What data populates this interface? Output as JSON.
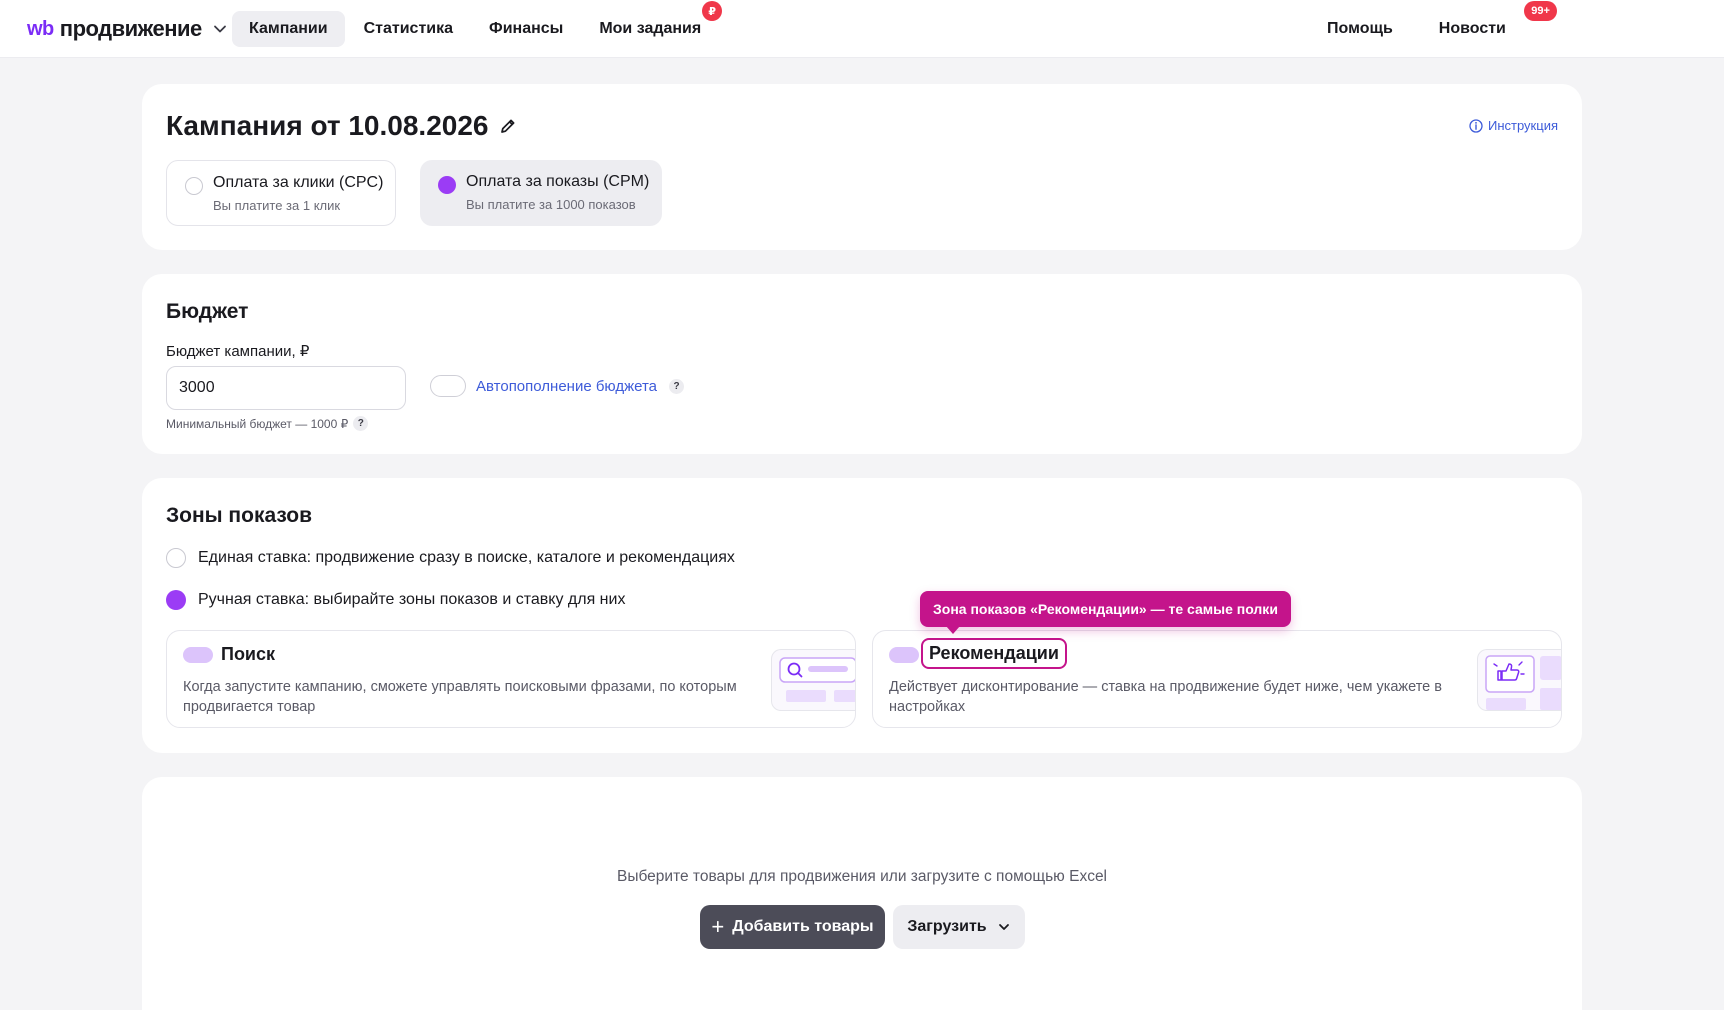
{
  "header": {
    "logo_mark": "wb",
    "logo_word": "продвижение",
    "nav": [
      {
        "label": "Кампании",
        "active": true
      },
      {
        "label": "Статистика",
        "active": false
      },
      {
        "label": "Финансы",
        "active": false
      },
      {
        "label": "Мои задания",
        "active": false,
        "badge": "₽"
      }
    ],
    "right": [
      {
        "label": "Помощь"
      },
      {
        "label": "Новости",
        "badge": "99+"
      }
    ]
  },
  "campaign": {
    "title": "Кампания от 10.08.2026",
    "instruction_link": "Инструкция",
    "payment_options": [
      {
        "label": "Оплата за клики (CPC)",
        "sub": "Вы платите за 1 клик",
        "selected": false
      },
      {
        "label": "Оплата за показы (CPM)",
        "sub": "Вы платите за 1000 показов",
        "selected": true
      }
    ]
  },
  "budget": {
    "title": "Бюджет",
    "field_label": "Бюджет кампании, ₽",
    "value": "3000",
    "hint": "Минимальный бюджет — 1000 ₽",
    "autofill_label": "Автопополнение бюджета",
    "help_mark": "?"
  },
  "zones": {
    "title": "Зоны показов",
    "options": [
      {
        "label": "Единая ставка: продвижение сразу в поиске, каталоге и рекомендациях",
        "selected": false
      },
      {
        "label": "Ручная ставка: выбирайте зоны показов и ставку для них",
        "selected": true
      }
    ],
    "cards": [
      {
        "name": "Поиск",
        "desc": "Когда запустите кампанию, сможете управлять поисковыми фразами, по которым продвигается товар"
      },
      {
        "name": "Рекомендации",
        "desc": "Действует дисконтирование — ставка на продвижение будет ниже, чем укажете в настройках"
      }
    ],
    "tooltip": "Зона показов «Рекомендации» — те самые полки"
  },
  "products": {
    "empty_text": "Выберите товары для продвижения или загрузите с помощью Excel",
    "add_button": "Добавить товары",
    "add_button_icon": "+",
    "load_button": "Загрузить"
  },
  "colors": {
    "accent": "#9b3cf5",
    "brand": "#7b2cf6",
    "badge": "#f0374a",
    "link": "#3d5bd9",
    "tooltip": "#c4148b"
  }
}
